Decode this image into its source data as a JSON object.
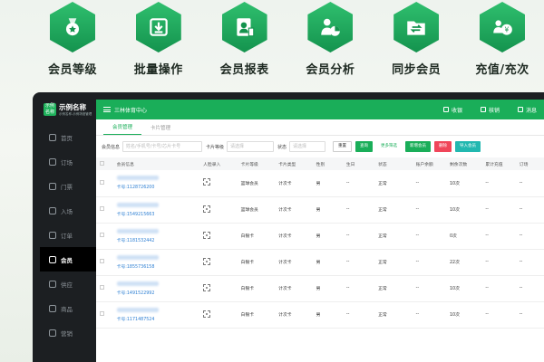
{
  "features": [
    {
      "label": "会员等级",
      "icon": "medal-icon"
    },
    {
      "label": "批量操作",
      "icon": "download-box-icon"
    },
    {
      "label": "会员报表",
      "icon": "user-report-icon"
    },
    {
      "label": "会员分析",
      "icon": "user-chart-icon"
    },
    {
      "label": "同步会员",
      "icon": "folder-sync-icon"
    },
    {
      "label": "充值/充次",
      "icon": "users-coin-icon"
    }
  ],
  "sidebar": {
    "logo_box": "示例 名称",
    "logo_name": "示例名称",
    "logo_sub": "示例名称-示例场馆管理",
    "items": [
      {
        "label": "首页"
      },
      {
        "label": "订场"
      },
      {
        "label": "门票"
      },
      {
        "label": "入场"
      },
      {
        "label": "订单"
      },
      {
        "label": "会员",
        "active": true
      },
      {
        "label": "供应"
      },
      {
        "label": "商品"
      },
      {
        "label": "营销"
      }
    ]
  },
  "topbar": {
    "venue": "三林体育中心",
    "btn1": "收银",
    "btn2": "核销",
    "btn3": "消息"
  },
  "tabs": [
    "会员管理",
    "卡片管理"
  ],
  "filters": {
    "member_label": "会员信息",
    "member_placeholder": "姓名/手机号/卡号/芯片卡号",
    "level_label": "卡片等级",
    "level_placeholder": "请选择",
    "status_label": "状态",
    "status_placeholder": "请选择",
    "reset": "重置",
    "query": "查询",
    "more": "更多筛选",
    "add": "新增会员",
    "delete": "删除",
    "import": "导入会员"
  },
  "table": {
    "headers": [
      "",
      "会员信息",
      "人脸录入",
      "卡片等级",
      "卡片类型",
      "性别",
      "生日",
      "状态",
      "账户余额",
      "剩余次数",
      "累计充值",
      "订场"
    ],
    "rows": [
      {
        "card": "卡号:1128726200",
        "level": "篮球会员",
        "type": "计次卡",
        "sex": "男",
        "birthday": "--",
        "status": "正常",
        "balance": "--",
        "remaining": "10次",
        "total": "--",
        "order": "--"
      },
      {
        "card": "卡号:1549215663",
        "level": "篮球会员",
        "type": "计次卡",
        "sex": "男",
        "birthday": "--",
        "status": "正常",
        "balance": "--",
        "remaining": "10次",
        "total": "--",
        "order": "--"
      },
      {
        "card": "卡号:1181532442",
        "level": "白银卡",
        "type": "计次卡",
        "sex": "男",
        "birthday": "--",
        "status": "正常",
        "balance": "--",
        "remaining": "0次",
        "total": "--",
        "order": "--"
      },
      {
        "card": "卡号:1855736158",
        "level": "白银卡",
        "type": "计次卡",
        "sex": "男",
        "birthday": "--",
        "status": "正常",
        "balance": "--",
        "remaining": "22次",
        "total": "--",
        "order": "--"
      },
      {
        "card": "卡号:1491522992",
        "level": "白银卡",
        "type": "计次卡",
        "sex": "男",
        "birthday": "--",
        "status": "正常",
        "balance": "--",
        "remaining": "10次",
        "total": "--",
        "order": "--"
      },
      {
        "card": "卡号:1171487524",
        "level": "白银卡",
        "type": "计次卡",
        "sex": "男",
        "birthday": "--",
        "status": "正常",
        "balance": "--",
        "remaining": "10次",
        "total": "--",
        "order": "--"
      }
    ]
  }
}
